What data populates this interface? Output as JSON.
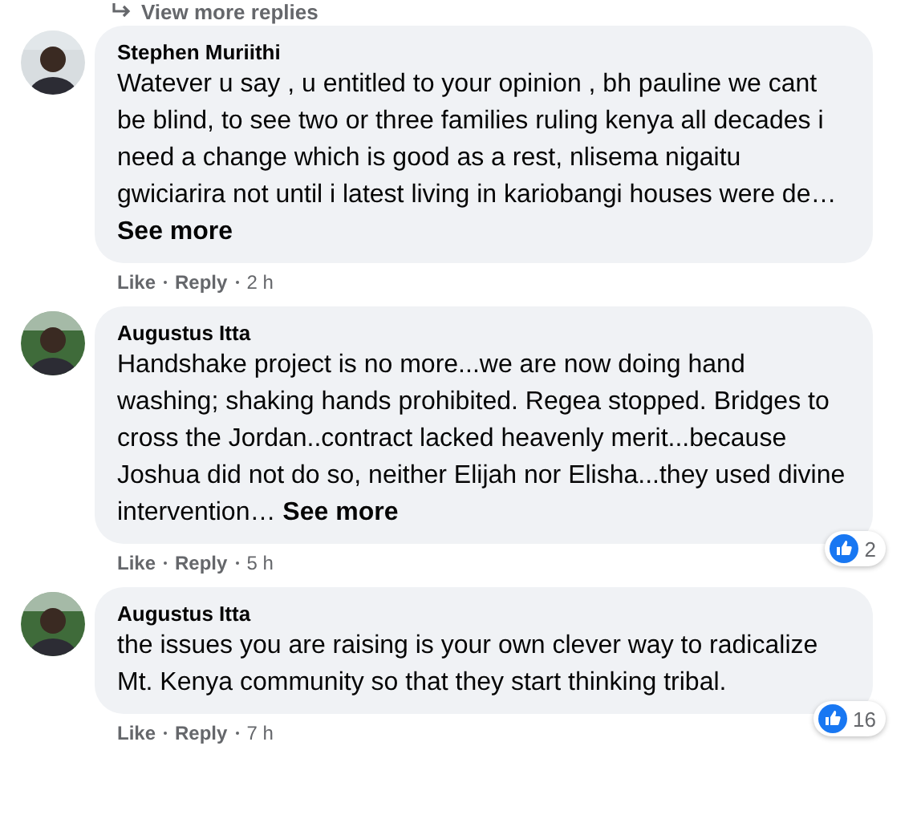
{
  "view_more_replies": "View more replies",
  "comments": [
    {
      "author": "Stephen Muriithi",
      "text": "Watever u say , u entitled to your opinion , bh pauline we cant be blind, to see two or three families ruling kenya all decades i need a change which is good as a rest, nlisema nigaitu gwiciarira not until i latest living in kariobangi houses were de…",
      "see_more": "See more",
      "like": "Like",
      "reply": "Reply",
      "time": "2 h"
    },
    {
      "author": "Augustus Itta",
      "text": "Handshake project is no more...we are now doing hand washing; shaking hands prohibited. Regea stopped. Bridges to cross the Jordan..contract lacked heavenly merit...because Joshua did not do so, neither Elijah nor Elisha...they used divine intervention…",
      "see_more": "See more",
      "like": "Like",
      "reply": "Reply",
      "time": "5 h",
      "reactions": "2"
    },
    {
      "author": "Augustus Itta",
      "text": "the issues you are raising is your own clever way to radicalize Mt. Kenya community so that they start thinking tribal.",
      "like": "Like",
      "reply": "Reply",
      "time": "7 h",
      "reactions": "16"
    }
  ]
}
